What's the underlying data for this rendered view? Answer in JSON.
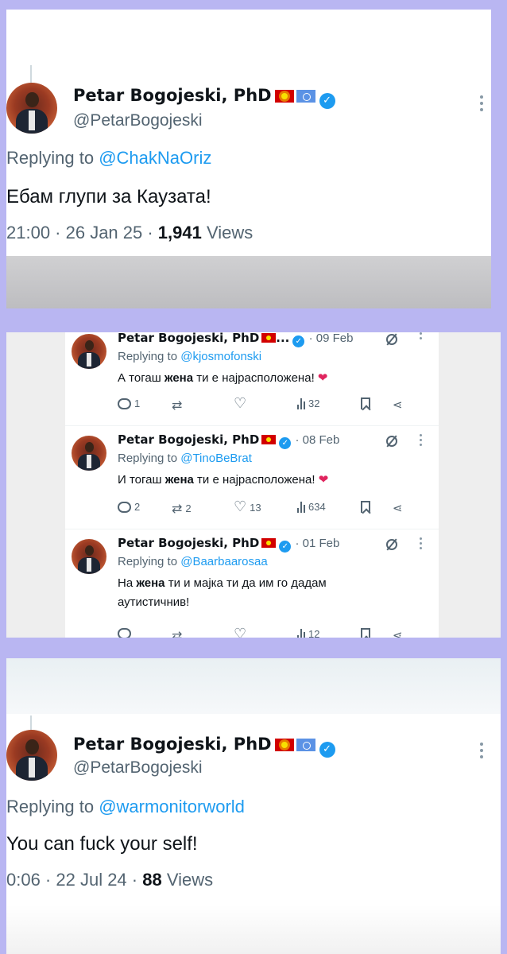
{
  "panel1": {
    "name": "Petar Bogojeski, PhD",
    "handle": "@PetarBogojeski",
    "replying_prefix": "Replying to ",
    "replying_to": "@ChakNaOriz",
    "text": "Ебам глупи за Каузата!",
    "time_date": "21:00 · 26 Jan 25 · ",
    "views_count": "1,941",
    "views_label": " Views"
  },
  "panel2": {
    "tweets": [
      {
        "name": "Petar Bogojeski, PhD",
        "name_suffix": "...",
        "date": "· 09 Feb",
        "replying_prefix": "Replying to ",
        "replying_to": "@kjosmofonski",
        "text_pre": "А тогаш ",
        "text_bold": "жена",
        "text_post": " ти е најрасположена! ",
        "heart": "❤",
        "replies": "1",
        "retweets": "",
        "likes": "",
        "views": "32"
      },
      {
        "name": "Petar Bogojeski, PhD",
        "name_suffix": "",
        "date": "· 08 Feb",
        "replying_prefix": "Replying to ",
        "replying_to": "@TinoBeBrat",
        "text_pre": "И тогаш ",
        "text_bold": "жена",
        "text_post": " ти е најрасположена! ",
        "heart": "❤",
        "replies": "2",
        "retweets": "2",
        "likes": "13",
        "views": "634"
      },
      {
        "name": "Petar Bogojeski, PhD",
        "name_suffix": "",
        "date": "· 01 Feb",
        "replying_prefix": "Replying to ",
        "replying_to": "@Baarbaarosaa",
        "text_pre": "На ",
        "text_bold": "жена",
        "text_post": " ти и мајка ти да им го дадам аутистичнив!",
        "heart": "",
        "replies": "",
        "retweets": "",
        "likes": "",
        "views": "12"
      }
    ]
  },
  "panel3": {
    "name": "Petar Bogojeski, PhD",
    "handle": "@PetarBogojeski",
    "replying_prefix": "Replying to ",
    "replying_to": "@warmonitorworld",
    "text": "You can fuck your self!",
    "time_date": "0:06 · 22 Jul 24 · ",
    "views_count": "88",
    "views_label": " Views"
  },
  "icons": {
    "verified": "✓",
    "retweet": "⇄",
    "like": "♡",
    "share": "⋖"
  },
  "colors": {
    "background": "#b9b6f2",
    "link": "#1d9bf0",
    "verified": "#1d9bf0",
    "heart": "#e0245e",
    "muted": "#536471"
  }
}
